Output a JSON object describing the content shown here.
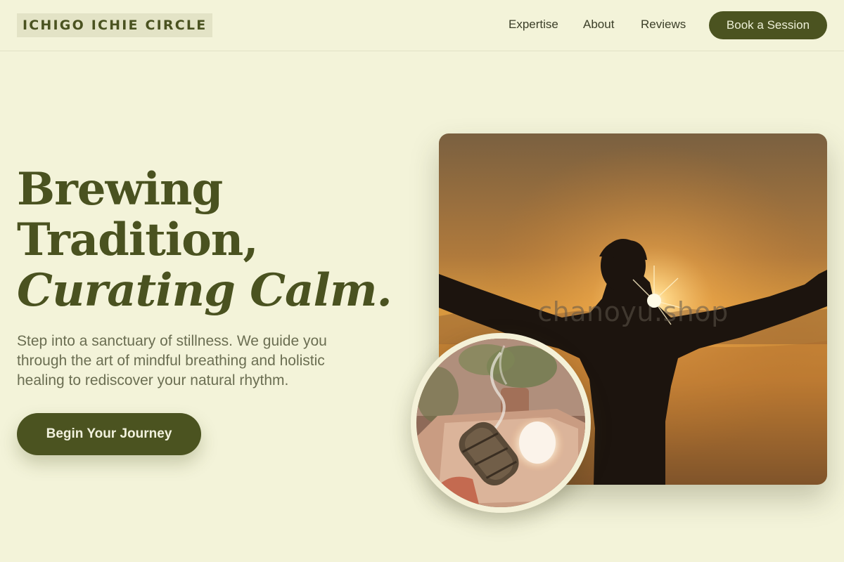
{
  "header": {
    "logo": "ICHIGO ICHIE CIRCLE",
    "nav": [
      "Expertise",
      "About",
      "Reviews"
    ],
    "cta": "Book a Session"
  },
  "hero": {
    "headline_line1": "Brewing",
    "headline_line2": "Tradition,",
    "headline_line3": "Curating Calm.",
    "subtext": "Step into a sanctuary of stillness. We guide you through the art of mindful breathing and holistic healing to rediscover your natural rhythm.",
    "cta": "Begin Your Journey"
  },
  "images": {
    "main_watermark": "chanoyu.shop"
  },
  "colors": {
    "background": "#f3f3d9",
    "accent": "#4b5320",
    "text": "#4a5220"
  }
}
